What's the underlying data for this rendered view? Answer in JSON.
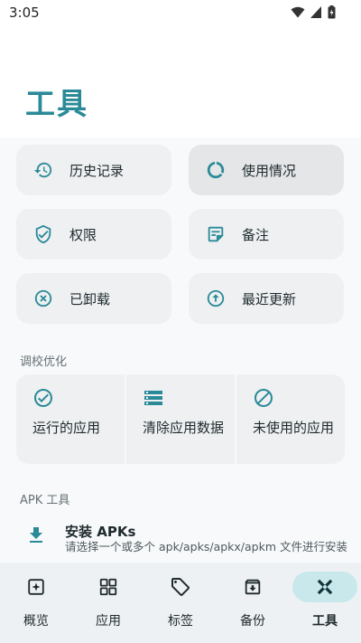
{
  "status_bar": {
    "time": "3:05"
  },
  "page": {
    "title": "工具"
  },
  "tiles": [
    {
      "label": "历史记录",
      "icon": "history-icon"
    },
    {
      "label": "使用情况",
      "icon": "usage-icon"
    },
    {
      "label": "权限",
      "icon": "shield-icon"
    },
    {
      "label": "备注",
      "icon": "note-icon"
    },
    {
      "label": "已卸载",
      "icon": "uninstalled-icon"
    },
    {
      "label": "最近更新",
      "icon": "update-icon"
    }
  ],
  "tuning": {
    "section_label": "调校优化",
    "options": [
      {
        "label": "运行的应用",
        "icon": "check-circle-icon"
      },
      {
        "label": "清除应用数据",
        "icon": "storage-icon"
      },
      {
        "label": "未使用的应用",
        "icon": "block-icon"
      }
    ]
  },
  "apk_tools": {
    "section_label": "APK 工具",
    "item": {
      "title": "安装 APKs",
      "description": "请选择一个或多个 apk/apks/apkx/apkm 文件进行安装",
      "icon": "download-icon"
    }
  },
  "nav": [
    {
      "label": "概览",
      "icon": "overview-icon"
    },
    {
      "label": "应用",
      "icon": "apps-grid-icon"
    },
    {
      "label": "标签",
      "icon": "tags-icon"
    },
    {
      "label": "备份",
      "icon": "backup-icon"
    },
    {
      "label": "工具",
      "icon": "tools-icon"
    }
  ],
  "colors": {
    "accent": "#2a8a97",
    "active_pill": "#c9e8ec",
    "tile_bg": "#eef0f2"
  }
}
